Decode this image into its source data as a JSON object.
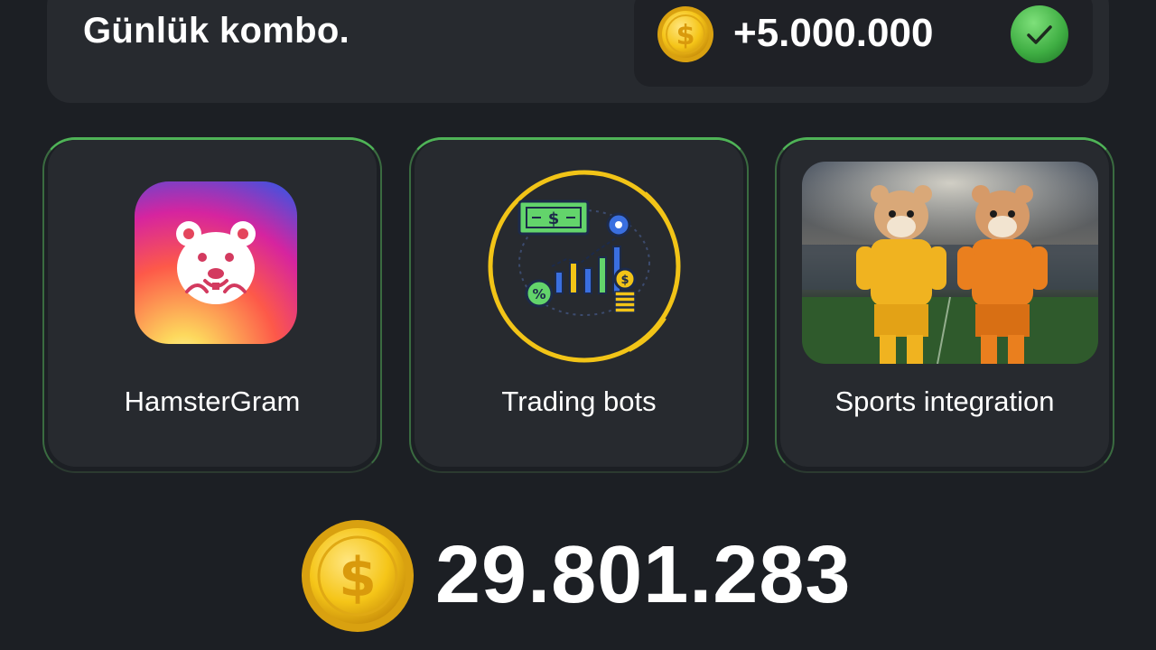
{
  "combo": {
    "title": "Günlük kombo.",
    "reward_amount": "+5.000.000",
    "status_icon": "check-icon",
    "status_color": "#43b14b"
  },
  "cards": [
    {
      "label": "HamsterGram",
      "icon": "hamster-app-icon"
    },
    {
      "label": "Trading bots",
      "icon": "trading-chart-icon"
    },
    {
      "label": "Sports integration",
      "icon": "hamsters-football-image"
    }
  ],
  "balance": {
    "value": "29.801.283",
    "icon": "coin-icon"
  },
  "colors": {
    "background": "#1c1f24",
    "panel": "#272a2f",
    "accent_green": "#4fb357",
    "coin": "#f5c518"
  }
}
